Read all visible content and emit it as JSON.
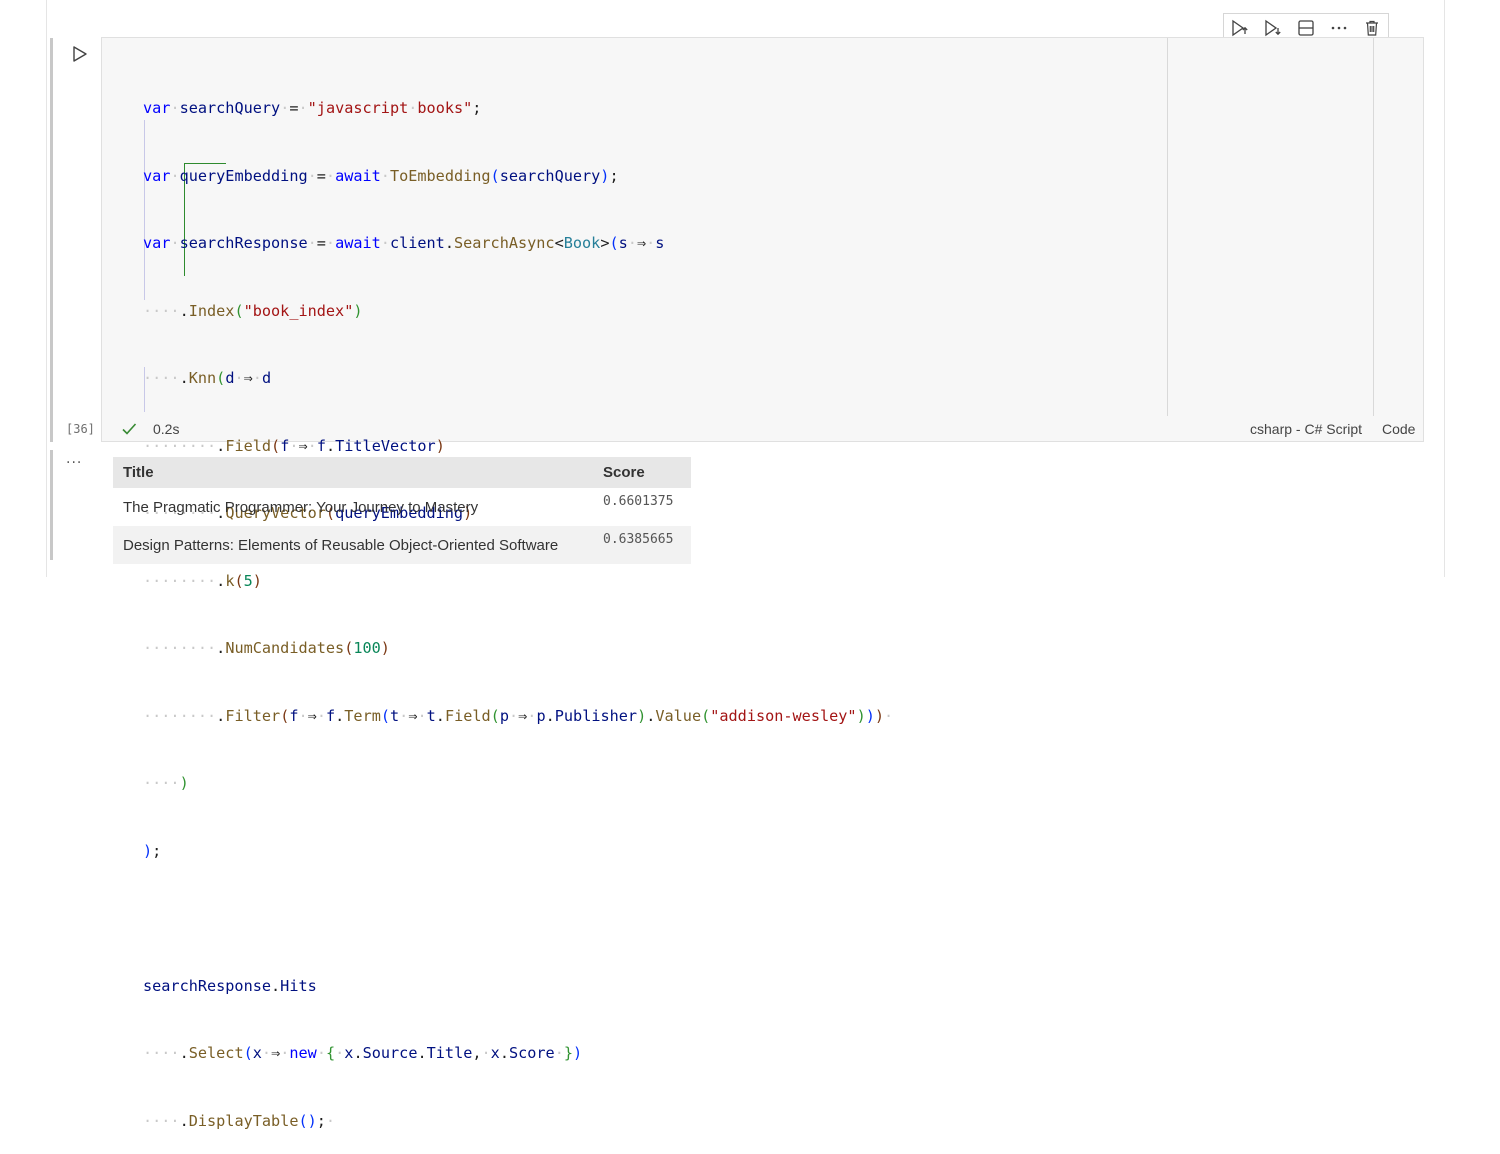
{
  "cell": {
    "execution_count": "[36]",
    "duration": "0.2s",
    "kernel": "csharp - C# Script",
    "cell_type": "Code",
    "status_icon": "check-icon",
    "run_icon": "play-icon"
  },
  "toolbar": {
    "buttons": [
      {
        "name": "execute-above-button",
        "icon": "run-above-icon"
      },
      {
        "name": "execute-below-button",
        "icon": "run-below-icon"
      },
      {
        "name": "split-cell-button",
        "icon": "split-icon"
      },
      {
        "name": "more-actions-button",
        "icon": "ellipsis-icon"
      },
      {
        "name": "delete-cell-button",
        "icon": "trash-icon"
      }
    ]
  },
  "code": {
    "lines": [
      "var searchQuery = \"javascript books\";",
      "var queryEmbedding = await ToEmbedding(searchQuery);",
      "var searchResponse = await client.SearchAsync<Book>(s => s",
      "    .Index(\"book_index\")",
      "    .Knn(d => d",
      "        .Field(f => f.TitleVector)",
      "        .QueryVector(queryEmbedding)",
      "        .k(5)",
      "        .NumCandidates(100)",
      "        .Filter(f => f.Term(t => t.Field(p => p.Publisher).Value(\"addison-wesley\"))) ",
      "    )",
      ");",
      "",
      "searchResponse.Hits",
      "    .Select(x => new { x.Source.Title, x.Score })",
      "    .DisplayTable(); "
    ]
  },
  "output": {
    "more_icon": "ellipsis-icon",
    "columns": [
      "Title",
      "Score"
    ],
    "rows": [
      [
        "The Pragmatic Programmer: Your Journey to Mastery",
        "0.6601375"
      ],
      [
        "Design Patterns: Elements of Reusable Object-Oriented Software",
        "0.6385665"
      ]
    ]
  }
}
